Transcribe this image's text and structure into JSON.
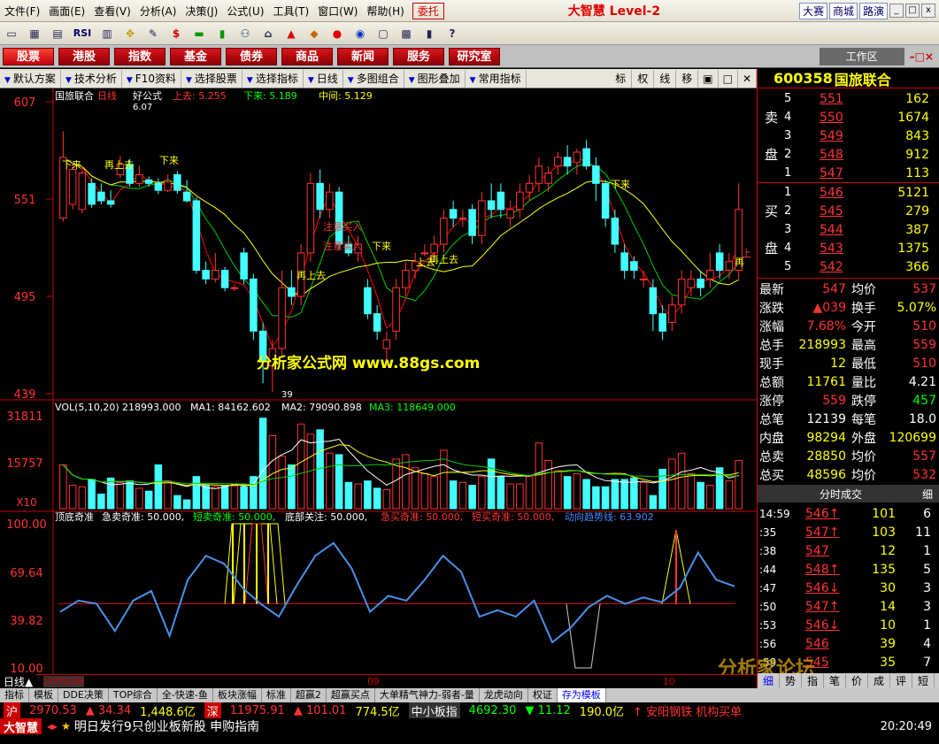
{
  "menu": {
    "items": [
      "文件(F)",
      "画面(E)",
      "查看(V)",
      "分析(A)",
      "决策(J)",
      "公式(U)",
      "工具(T)",
      "窗口(W)",
      "帮助(H)"
    ],
    "weituo": "委托",
    "title": "大智慧 Level-2",
    "right_buttons": [
      "大赛",
      "商城",
      "路演"
    ]
  },
  "toolbar": {
    "icons": [
      "folder-icon",
      "chart-icon",
      "grid-icon",
      "rsi-icon",
      "table-icon",
      "cross-icon",
      "pen-icon",
      "dollar-icon",
      "stack-icon",
      "bar-icon",
      "binoculars-icon",
      "bell-icon",
      "warn-icon",
      "diamond-icon",
      "disc-icon",
      "globe-icon",
      "note-icon",
      "calc-icon",
      "book-icon",
      "help-icon"
    ],
    "rsi": "RSI"
  },
  "nav": {
    "items": [
      "股票",
      "港股",
      "指数",
      "基金",
      "债券",
      "商品",
      "新闻",
      "服务",
      "研究室"
    ],
    "workspace": "工作区"
  },
  "subbar": {
    "items": [
      "默认方案",
      "技术分析",
      "F10资料",
      "选择股票",
      "选择指标",
      "日线",
      "多图组合",
      "图形叠加",
      "常用指标"
    ],
    "right": [
      "标",
      "权",
      "线",
      "移"
    ]
  },
  "chart": {
    "header": {
      "name": "国旅联合",
      "period": "日线",
      "formula": "好公式",
      "up": "上去: 5.255",
      "down": "下来: 5.189",
      "mid": "中间: 5.129"
    },
    "price_axis": [
      "607",
      "551",
      "495",
      "439"
    ],
    "high_label": "6.07",
    "low_label": "39",
    "watermark": "分析家公式网 www.88gs.com",
    "annotations": [
      {
        "t": "下来",
        "c": "#ff0"
      },
      {
        "t": "再上去",
        "c": "#ff0"
      },
      {
        "t": "下来",
        "c": "#ff0"
      },
      {
        "t": "注意买入",
        "c": "#f33"
      },
      {
        "t": "注意买入",
        "c": "#f33"
      },
      {
        "t": "下来",
        "c": "#ff0"
      },
      {
        "t": "再上去",
        "c": "#ff0"
      },
      {
        "t": "上去",
        "c": "#ff0"
      },
      {
        "t": "再上去",
        "c": "#ff0"
      },
      {
        "t": "下来",
        "c": "#ff0"
      },
      {
        "t": "再",
        "c": "#ff0"
      },
      {
        "t": "上",
        "c": "#f33"
      }
    ],
    "vol_header": {
      "title": "VOL(5,10,20)",
      "vol": "218993.000",
      "ma1": "MA1: 84162.602",
      "ma2": "MA2: 79090.898",
      "ma3": "MA3: 118649.000"
    },
    "vol_axis": [
      "31811",
      "15757",
      "X10"
    ],
    "ind_header": {
      "title": "顶底奇准",
      "a": "急卖奇准: 50.000,",
      "b": "短卖奇准: 50.000,",
      "c": "底部关注: 50.000,",
      "d": "急买奇准: 50.000,",
      "e": "短买奇准: 50.000,",
      "f": "动向趋势线: 63.902"
    },
    "ind_axis": [
      "100.00",
      "69.64",
      "39.82",
      "10.00"
    ],
    "dates": [
      "2009/08",
      "09",
      "10"
    ]
  },
  "chart_data": {
    "type": "candlestick",
    "x": [
      "2009/08",
      "09",
      "10"
    ],
    "y_axis": [
      439,
      495,
      551,
      607
    ],
    "candles": [
      [
        540,
        575,
        538,
        590
      ],
      [
        548,
        568,
        545,
        572
      ],
      [
        545,
        566,
        543,
        570
      ],
      [
        560,
        548,
        546,
        563
      ],
      [
        555,
        550,
        548,
        560
      ],
      [
        550,
        548,
        546,
        556
      ],
      [
        565,
        571,
        563,
        576
      ],
      [
        571,
        560,
        558,
        574
      ],
      [
        560,
        565,
        558,
        570
      ],
      [
        562,
        560,
        558,
        564
      ],
      [
        560,
        556,
        554,
        563
      ],
      [
        556,
        561,
        555,
        565
      ],
      [
        565,
        556,
        554,
        567
      ],
      [
        555,
        550,
        549,
        562
      ],
      [
        550,
        510,
        508,
        552
      ],
      [
        510,
        505,
        502,
        515
      ],
      [
        505,
        510,
        503,
        520
      ],
      [
        510,
        500,
        498,
        512
      ],
      [
        500,
        500,
        498,
        502
      ],
      [
        520,
        505,
        502,
        523
      ],
      [
        505,
        475,
        470,
        508
      ],
      [
        475,
        458,
        445,
        480
      ],
      [
        455,
        465,
        440,
        470
      ],
      [
        465,
        500,
        460,
        510
      ],
      [
        500,
        495,
        490,
        510
      ],
      [
        495,
        520,
        490,
        525
      ],
      [
        520,
        560,
        515,
        566
      ],
      [
        560,
        545,
        540,
        568
      ],
      [
        545,
        555,
        540,
        560
      ],
      [
        555,
        525,
        522,
        558
      ],
      [
        525,
        520,
        518,
        530
      ],
      [
        520,
        525,
        515,
        530
      ],
      [
        500,
        485,
        482,
        505
      ],
      [
        485,
        475,
        470,
        490
      ],
      [
        465,
        470,
        455,
        475
      ],
      [
        475,
        500,
        470,
        505
      ],
      [
        500,
        510,
        495,
        515
      ],
      [
        510,
        515,
        505,
        520
      ],
      [
        520,
        520,
        518,
        525
      ],
      [
        520,
        525,
        515,
        530
      ],
      [
        525,
        540,
        520,
        545
      ],
      [
        545,
        540,
        535,
        550
      ],
      [
        540,
        540,
        535,
        545
      ],
      [
        545,
        530,
        525,
        548
      ],
      [
        530,
        550,
        525,
        555
      ],
      [
        550,
        545,
        540,
        560
      ],
      [
        555,
        545,
        540,
        560
      ],
      [
        540,
        545,
        535,
        550
      ],
      [
        545,
        555,
        540,
        560
      ],
      [
        555,
        560,
        550,
        565
      ],
      [
        560,
        570,
        555,
        575
      ],
      [
        560,
        566,
        555,
        570
      ],
      [
        570,
        575,
        565,
        578
      ],
      [
        575,
        570,
        565,
        582
      ],
      [
        572,
        578,
        565,
        580
      ],
      [
        580,
        570,
        568,
        585
      ],
      [
        570,
        560,
        550,
        575
      ],
      [
        560,
        540,
        535,
        562
      ],
      [
        540,
        525,
        520,
        545
      ],
      [
        520,
        510,
        505,
        525
      ],
      [
        515,
        510,
        505,
        518
      ],
      [
        505,
        505,
        500,
        510
      ],
      [
        500,
        485,
        475,
        505
      ],
      [
        485,
        475,
        470,
        490
      ],
      [
        480,
        490,
        475,
        495
      ],
      [
        490,
        505,
        485,
        510
      ],
      [
        500,
        505,
        495,
        510
      ],
      [
        505,
        500,
        495,
        510
      ],
      [
        505,
        510,
        500,
        520
      ],
      [
        520,
        510,
        505,
        525
      ],
      [
        510,
        515,
        505,
        520
      ],
      [
        510,
        545,
        505,
        560
      ]
    ],
    "volume": [
      15000,
      8000,
      7500,
      10000,
      5000,
      10500,
      9000,
      9500,
      7000,
      6000,
      15000,
      9500,
      4500,
      3000,
      11000,
      8000,
      7500,
      8000,
      7800,
      7500,
      11000,
      31000,
      25000,
      18000,
      15000,
      29000,
      25500,
      27000,
      19000,
      18500,
      9000,
      8500,
      9500,
      7000,
      6500,
      17000,
      18500,
      14000,
      12000,
      11000,
      20000,
      9500,
      9000,
      8000,
      11000,
      17000,
      11000,
      8500,
      8500,
      11000,
      22500,
      16500,
      13000,
      11000,
      12000,
      10000,
      7500,
      7500,
      10000,
      10000,
      10500,
      9000,
      4500,
      13500,
      17000,
      19000,
      12000,
      9000,
      8000,
      14000,
      9500,
      16500
    ],
    "trend": [
      45,
      52,
      50,
      33,
      52,
      58,
      30,
      65,
      80,
      75,
      60,
      50,
      42,
      62,
      80,
      88,
      72,
      45,
      55,
      52,
      65,
      80,
      70,
      42,
      46,
      42,
      52,
      26,
      35,
      48,
      55,
      50,
      54,
      51,
      60,
      82,
      65,
      61
    ]
  },
  "rp": {
    "code": "600358",
    "name": "国旅联合",
    "sell": [
      [
        "5",
        "551",
        "162"
      ],
      [
        "4",
        "550",
        "1674"
      ],
      [
        "3",
        "549",
        "843"
      ],
      [
        "2",
        "548",
        "912"
      ],
      [
        "1",
        "547",
        "113"
      ]
    ],
    "buy": [
      [
        "1",
        "546",
        "5121"
      ],
      [
        "2",
        "545",
        "279"
      ],
      [
        "3",
        "544",
        "387"
      ],
      [
        "4",
        "543",
        "1375"
      ],
      [
        "5",
        "542",
        "366"
      ]
    ],
    "sell_label": [
      "卖",
      "盘"
    ],
    "buy_label": [
      "买",
      "盘"
    ],
    "stats": [
      [
        "最新",
        "547",
        "均价",
        "537"
      ],
      [
        "涨跌",
        "▲039",
        "换手",
        "5.07%"
      ],
      [
        "涨幅",
        "7.68%",
        "今开",
        "510"
      ],
      [
        "总手",
        "218993",
        "最高",
        "559"
      ],
      [
        "现手",
        "12",
        "最低",
        "510"
      ],
      [
        "总额",
        "11761",
        "量比",
        "4.21"
      ],
      [
        "涨停",
        "559",
        "跌停",
        "457"
      ],
      [
        "总笔",
        "12139",
        "每笔",
        "18.0"
      ],
      [
        "内盘",
        "98294",
        "外盘",
        "120699"
      ],
      [
        "总卖",
        "28850",
        "均价",
        "557"
      ],
      [
        "总买",
        "48596",
        "均价",
        "532"
      ]
    ],
    "ticks_title": "分时成交",
    "ticks_btn": "细",
    "ticks": [
      [
        "14:59",
        "546↑",
        "101",
        "6"
      ],
      [
        ":35",
        "547↑",
        "103",
        "11"
      ],
      [
        ":38",
        "547",
        "12",
        "1"
      ],
      [
        ":44",
        "548↑",
        "135",
        "5"
      ],
      [
        ":47",
        "546↓",
        "30",
        "3"
      ],
      [
        ":50",
        "547↑",
        "14",
        "3"
      ],
      [
        ":53",
        "546↓",
        "10",
        "1"
      ],
      [
        ":56",
        "546",
        "39",
        "4"
      ],
      [
        ":59",
        "545",
        "35",
        "7"
      ]
    ],
    "watermark": "分析家论坛",
    "tabs": [
      "细",
      "势",
      "指",
      "笔",
      "价",
      "成",
      "评",
      "短"
    ]
  },
  "bottom": {
    "period": "日线▲",
    "tabs": [
      "指标",
      "模板",
      "DDE决策",
      "TOP综合",
      "全-快速-鱼",
      "板块涨幅",
      "标准",
      "超赢2",
      "超赢买点",
      "大单精气神力-弱者-量",
      "龙虎动向",
      "权证",
      "存为模板"
    ],
    "market": [
      "沪",
      "2970.53",
      "▲ 34.34",
      "1,448.6亿",
      "深",
      "11975.91",
      "▲ 101.01",
      "774.5亿",
      "中小板指",
      "4692.30",
      "▼ 11.12",
      "190.0亿",
      "↑ 安阳钢铁 机构买单"
    ],
    "news": "明日发行9只创业板新股 申购指南",
    "logo": "大智慧",
    "time": "20:20:49"
  }
}
